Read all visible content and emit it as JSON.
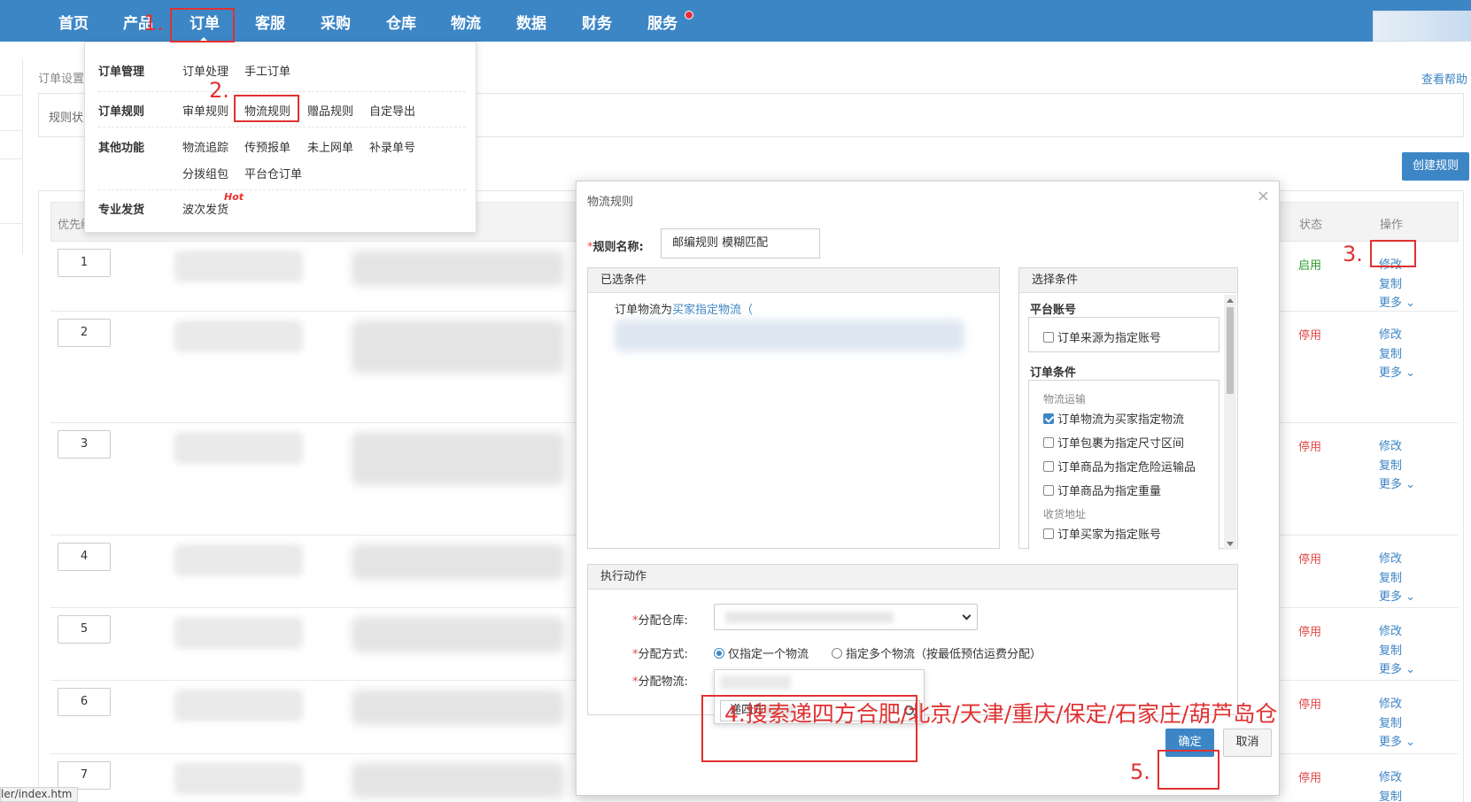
{
  "nav": {
    "items": [
      "首页",
      "产品",
      "订单",
      "客服",
      "采购",
      "仓库",
      "物流",
      "数据",
      "财务",
      "服务"
    ]
  },
  "page": {
    "crumb": "订单设置",
    "help": "查看帮助",
    "filter_label": "规则状",
    "create_button": "创建规则",
    "url": "ler/index.htm"
  },
  "table": {
    "headers": {
      "priority": "优先级",
      "status": "状态",
      "actions": "操作"
    },
    "rows": [
      {
        "priority": "1",
        "status": "启用",
        "enabled": true
      },
      {
        "priority": "2",
        "status": "停用",
        "enabled": false
      },
      {
        "priority": "3",
        "status": "停用",
        "enabled": false
      },
      {
        "priority": "4",
        "status": "停用",
        "enabled": false
      },
      {
        "priority": "5",
        "status": "停用",
        "enabled": false
      },
      {
        "priority": "6",
        "status": "停用",
        "enabled": false
      },
      {
        "priority": "7",
        "status": "停用",
        "enabled": false
      }
    ],
    "actions": {
      "edit": "修改",
      "copy": "复制",
      "more": "更多"
    }
  },
  "menu": {
    "categories": {
      "order_mgmt": "订单管理",
      "order_rules": "订单规则",
      "other": "其他功能",
      "pro_ship": "专业发货"
    },
    "links": {
      "order_process": "订单处理",
      "manual_order": "手工订单",
      "audit_rule": "审单规则",
      "logistics_rule": "物流规则",
      "gift_rule": "赠品规则",
      "custom_export": "自定导出",
      "tracking": "物流追踪",
      "pre_report": "传预报单",
      "not_online": "未上网单",
      "supplement": "补录单号",
      "split_merge": "分拨组包",
      "platform_warehouse": "平台仓订单",
      "wave_ship": "波次发货"
    },
    "hot": "Hot"
  },
  "annotations": {
    "a1": "1.",
    "a2": "2.",
    "a3": "3.",
    "a4": "4.搜索递四方合肥/北京/天津/重庆/保定/石家庄/葫芦岛仓",
    "a5": "5."
  },
  "modal": {
    "title": "物流规则",
    "close": "×",
    "name_label": "规则名称:",
    "name_value": "邮编规则 模糊匹配",
    "selected_panel": "已选条件",
    "selected_prefix": "订单物流为",
    "selected_link": "买家指定物流（",
    "choose_panel": "选择条件",
    "platform_section": "平台账号",
    "platform_cb": "订单来源为指定账号",
    "order_section": "订单条件",
    "group_logistics": "物流运输",
    "cb1": "订单物流为买家指定物流",
    "cb2": "订单包裹为指定尺寸区间",
    "cb3": "订单商品为指定危险运输品",
    "cb4": "订单商品为指定重量",
    "group_address": "收货地址",
    "cb5": "订单买家为指定账号",
    "action_panel": "执行动作",
    "warehouse_label": "分配仓库:",
    "method_label": "分配方式:",
    "radio_single": "仅指定一个物流",
    "radio_multi": "指定多个物流（按最低预估运费分配）",
    "logistics_label": "分配物流:",
    "search_value": "递四方",
    "ok": "确定",
    "cancel": "取消"
  }
}
